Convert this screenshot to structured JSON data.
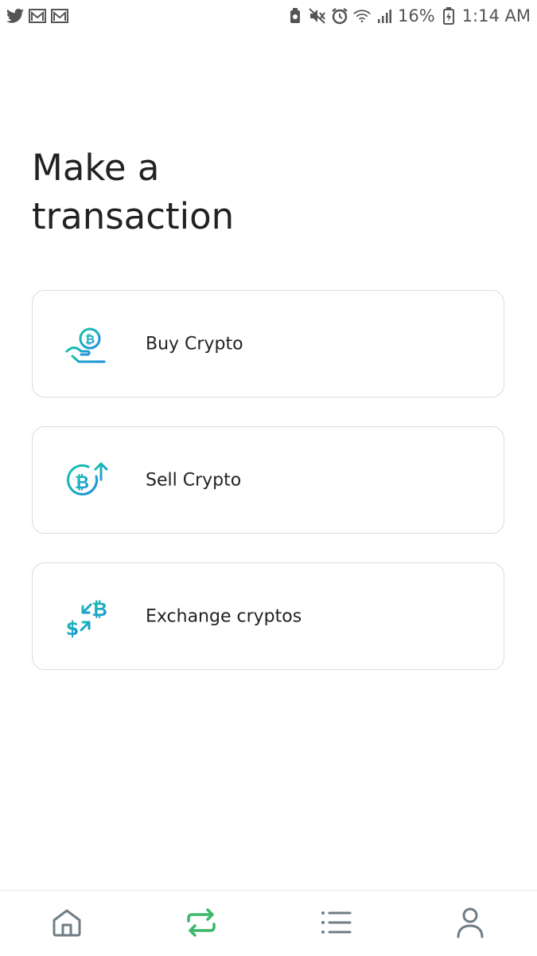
{
  "status_bar": {
    "battery_percent": "16%",
    "time": "1:14 AM",
    "left_icons": [
      "twitter-icon",
      "gmail-icon",
      "gmail-icon"
    ],
    "right_icons": [
      "battery-saver-icon",
      "mute-icon",
      "alarm-icon",
      "wifi-icon",
      "signal-icon",
      "battery-icon"
    ]
  },
  "page": {
    "title_line1": "Make a",
    "title_line2": "transaction"
  },
  "options": [
    {
      "label": "Buy Crypto",
      "icon": "buy-crypto-icon"
    },
    {
      "label": "Sell Crypto",
      "icon": "sell-crypto-icon"
    },
    {
      "label": "Exchange cryptos",
      "icon": "exchange-crypto-icon"
    }
  ],
  "bottom_nav": {
    "items": [
      "home-icon",
      "transactions-icon",
      "list-icon",
      "profile-icon"
    ],
    "active": "transactions-icon",
    "active_color": "#3db86b",
    "inactive_color": "#6f7d85"
  },
  "colors": {
    "accent_teal": "#19c4a8",
    "accent_blue": "#1d8fe0"
  }
}
